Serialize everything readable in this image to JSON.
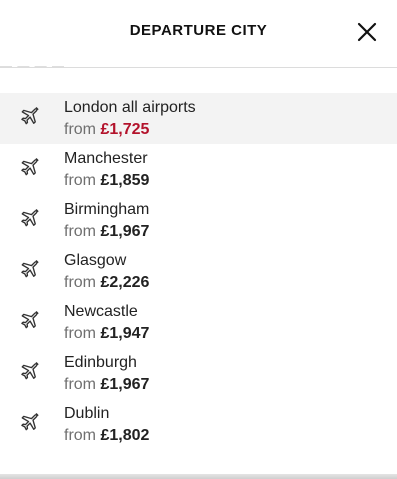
{
  "header": {
    "title": "DEPARTURE CITY",
    "close_icon": "close-icon"
  },
  "colors": {
    "highlight_price": "#b3122b",
    "highlight_row_bg": "#f3f3f3"
  },
  "departures": [
    {
      "city": "London all airports",
      "from_label": "from",
      "price": "£1,725",
      "icon": "plane-icon",
      "highlighted": true
    },
    {
      "city": "Manchester",
      "from_label": "from",
      "price": "£1,859",
      "icon": "plane-icon",
      "highlighted": false
    },
    {
      "city": "Birmingham",
      "from_label": "from",
      "price": "£1,967",
      "icon": "plane-icon",
      "highlighted": false
    },
    {
      "city": "Glasgow",
      "from_label": "from",
      "price": "£2,226",
      "icon": "plane-icon",
      "highlighted": false
    },
    {
      "city": "Newcastle",
      "from_label": "from",
      "price": "£1,947",
      "icon": "plane-icon",
      "highlighted": false
    },
    {
      "city": "Edinburgh",
      "from_label": "from",
      "price": "£1,967",
      "icon": "plane-icon",
      "highlighted": false
    },
    {
      "city": "Dublin",
      "from_label": "from",
      "price": "£1,802",
      "icon": "plane-icon",
      "highlighted": false
    }
  ]
}
